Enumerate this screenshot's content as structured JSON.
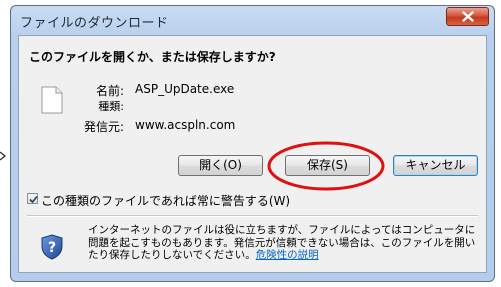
{
  "window": {
    "title": "ファイルのダウンロード",
    "close_label": "×"
  },
  "dialog": {
    "question": "このファイルを開くか、または保存しますか?",
    "file": {
      "name_label": "名前:",
      "name_value": "ASP_UpDate.exe",
      "type_label": "種類:",
      "type_value": "",
      "publisher_label": "発信元:",
      "publisher_value": "www.acspln.com"
    },
    "buttons": {
      "open": "開く(O)",
      "save": "保存(S)",
      "cancel": "キャンセル"
    },
    "checkbox": {
      "checked": true,
      "label": "この種類のファイルであれば常に警告する(W)"
    },
    "warning": {
      "text": "インターネットのファイルは役に立ちますが、ファイルによってはコンピュータに問題を起こすものもあります。発信元が信頼できない場合は、このファイルを開いたり保存したりしないでください。",
      "link": "危険性の説明"
    }
  },
  "colors": {
    "frame": "#b9d0ec",
    "client": "#f0f0f0",
    "highlight": "#e01010",
    "link": "#0066cc",
    "shield": "#2a5aa8"
  },
  "icons": {
    "close": "close-icon",
    "file": "file-icon",
    "shield": "shield-question-icon",
    "check": "checkmark-icon",
    "arrow": "arrow-pointer-icon"
  }
}
